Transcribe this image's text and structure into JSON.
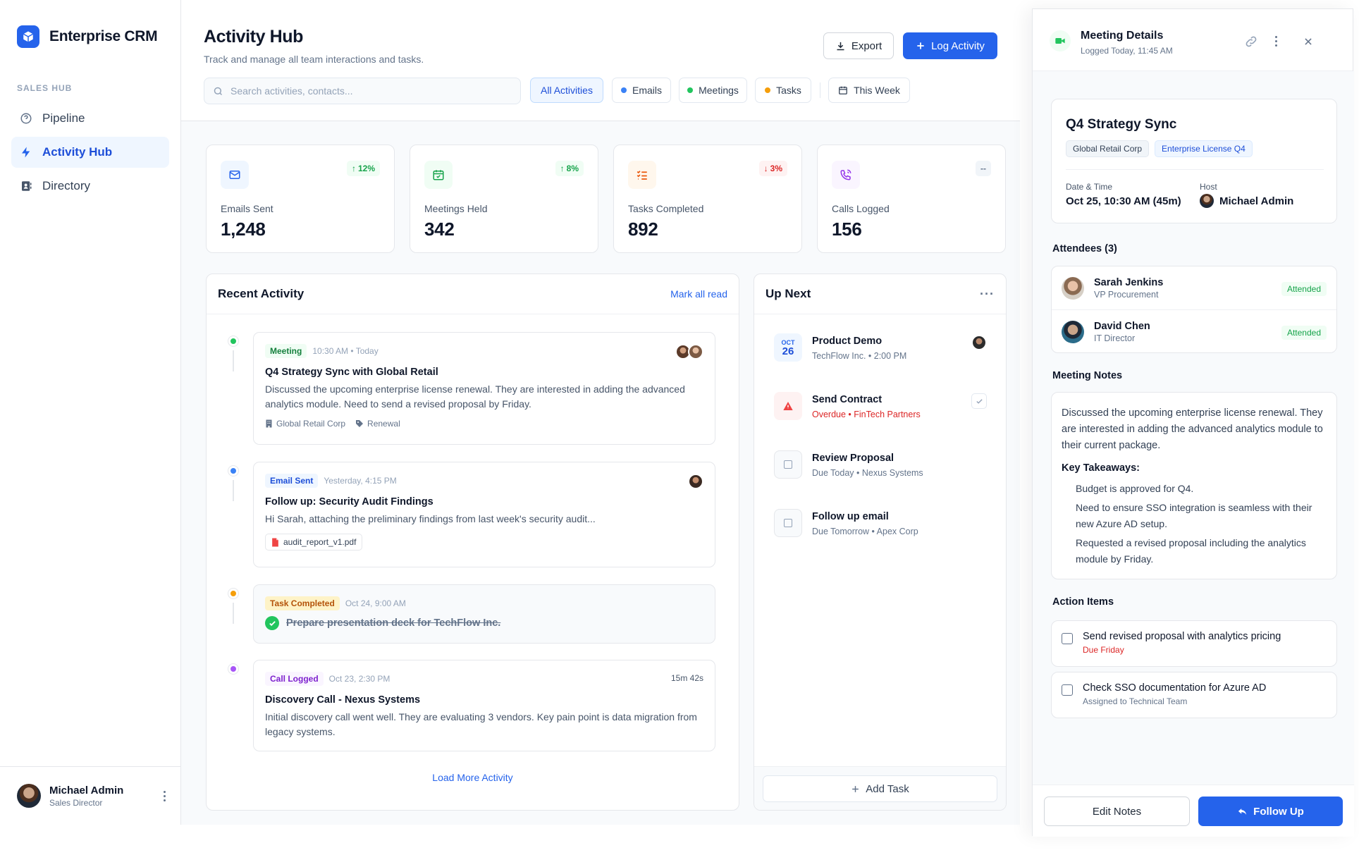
{
  "brand": {
    "name": "Enterprise CRM",
    "logo_icon": "cube-icon",
    "accent": "#2563eb"
  },
  "sidebar": {
    "section_label": "SALES HUB",
    "items": [
      {
        "label": "Pipeline",
        "icon": "help-circle-icon",
        "active": false
      },
      {
        "label": "Activity Hub",
        "icon": "lightning-icon",
        "active": true
      },
      {
        "label": "Directory",
        "icon": "contacts-book-icon",
        "active": false
      }
    ],
    "user": {
      "name": "Michael Admin",
      "role": "Sales Director"
    }
  },
  "header": {
    "title": "Activity Hub",
    "subtitle": "Track and manage all team interactions and tasks.",
    "export_label": "Export",
    "log_label": "Log Activity",
    "search_placeholder": "Search activities, contacts...",
    "filters": [
      {
        "label": "All Activities",
        "active": true,
        "dot": ""
      },
      {
        "label": "Emails",
        "active": false,
        "dot": "#3b82f6"
      },
      {
        "label": "Meetings",
        "active": false,
        "dot": "#22c55e"
      },
      {
        "label": "Tasks",
        "active": false,
        "dot": "#f59e0b"
      }
    ],
    "date_filter": "This Week"
  },
  "stats": [
    {
      "label": "Emails Sent",
      "value": "1,248",
      "trend": "12%",
      "direction": "up",
      "icon": "mail-icon",
      "color": "#2563eb"
    },
    {
      "label": "Meetings Held",
      "value": "342",
      "trend": "8%",
      "direction": "up",
      "icon": "calendar-check-icon",
      "color": "#16a34a"
    },
    {
      "label": "Tasks Completed",
      "value": "892",
      "trend": "3%",
      "direction": "down",
      "icon": "task-list-icon",
      "color": "#ea580c"
    },
    {
      "label": "Calls Logged",
      "value": "156",
      "trend": "--",
      "direction": "flat",
      "icon": "phone-call-icon",
      "color": "#9333ea"
    }
  ],
  "recent": {
    "title": "Recent Activity",
    "mark_read": "Mark all read",
    "load_more": "Load More Activity",
    "items": [
      {
        "tag": "Meeting",
        "time": "10:30 AM • Today",
        "title": "Q4 Strategy Sync with Global Retail",
        "desc": "Discussed the upcoming enterprise license renewal. They are interested in adding the advanced analytics module. Need to send a revised proposal by Friday.",
        "company": "Global Retail Corp",
        "label": "Renewal"
      },
      {
        "tag": "Email Sent",
        "time": "Yesterday, 4:15 PM",
        "title": "Follow up: Security Audit Findings",
        "desc": "Hi Sarah, attaching the preliminary findings from last week's security audit...",
        "attachment": "audit_report_v1.pdf"
      },
      {
        "tag": "Task Completed",
        "time": "Oct 24, 9:00 AM",
        "title": "Prepare presentation deck for TechFlow Inc."
      },
      {
        "tag": "Call Logged",
        "time": "Oct 23, 2:30 PM",
        "duration": "15m 42s",
        "title": "Discovery Call - Nexus Systems",
        "desc": "Initial discovery call went well. They are evaluating 3 vendors. Key pain point is data migration from legacy systems."
      }
    ]
  },
  "upnext": {
    "title": "Up Next",
    "add_task": "Add Task",
    "items": [
      {
        "title": "Product Demo",
        "sub": "TechFlow Inc. • 2:00 PM",
        "month": "OCT",
        "day": "26"
      },
      {
        "title": "Send Contract",
        "sub": "Overdue • FinTech Partners"
      },
      {
        "title": "Review Proposal",
        "sub": "Due Today • Nexus Systems"
      },
      {
        "title": "Follow up email",
        "sub": "Due Tomorrow • Apex Corp"
      }
    ]
  },
  "details": {
    "title": "Meeting Details",
    "logged": "Logged Today, 11:45 AM",
    "meeting_title": "Q4 Strategy Sync",
    "tags": [
      "Global Retail Corp",
      "Enterprise License Q4"
    ],
    "date_label": "Date & Time",
    "date_value": "Oct 25, 10:30 AM (45m)",
    "host_label": "Host",
    "host_value": "Michael Admin",
    "attendees_title": "Attendees (3)",
    "attendees": [
      {
        "name": "Sarah Jenkins",
        "role": "VP Procurement",
        "status": "Attended"
      },
      {
        "name": "David Chen",
        "role": "IT Director",
        "status": "Attended"
      }
    ],
    "notes_title": "Meeting Notes",
    "notes_body": "Discussed the upcoming enterprise license renewal. They are interested in adding the advanced analytics module to their current package.",
    "takeaways_title": "Key Takeaways:",
    "takeaways": [
      "Budget is approved for Q4.",
      "Need to ensure SSO integration is seamless with their new Azure AD setup.",
      "Requested a revised proposal including the analytics module by Friday."
    ],
    "actions_title": "Action Items",
    "actions": [
      {
        "title": "Send revised proposal with analytics pricing",
        "sub": "Due Friday"
      },
      {
        "title": "Check SSO documentation for Azure AD",
        "sub": "Assigned to Technical Team"
      }
    ],
    "edit_label": "Edit Notes",
    "follow_label": "Follow Up"
  }
}
